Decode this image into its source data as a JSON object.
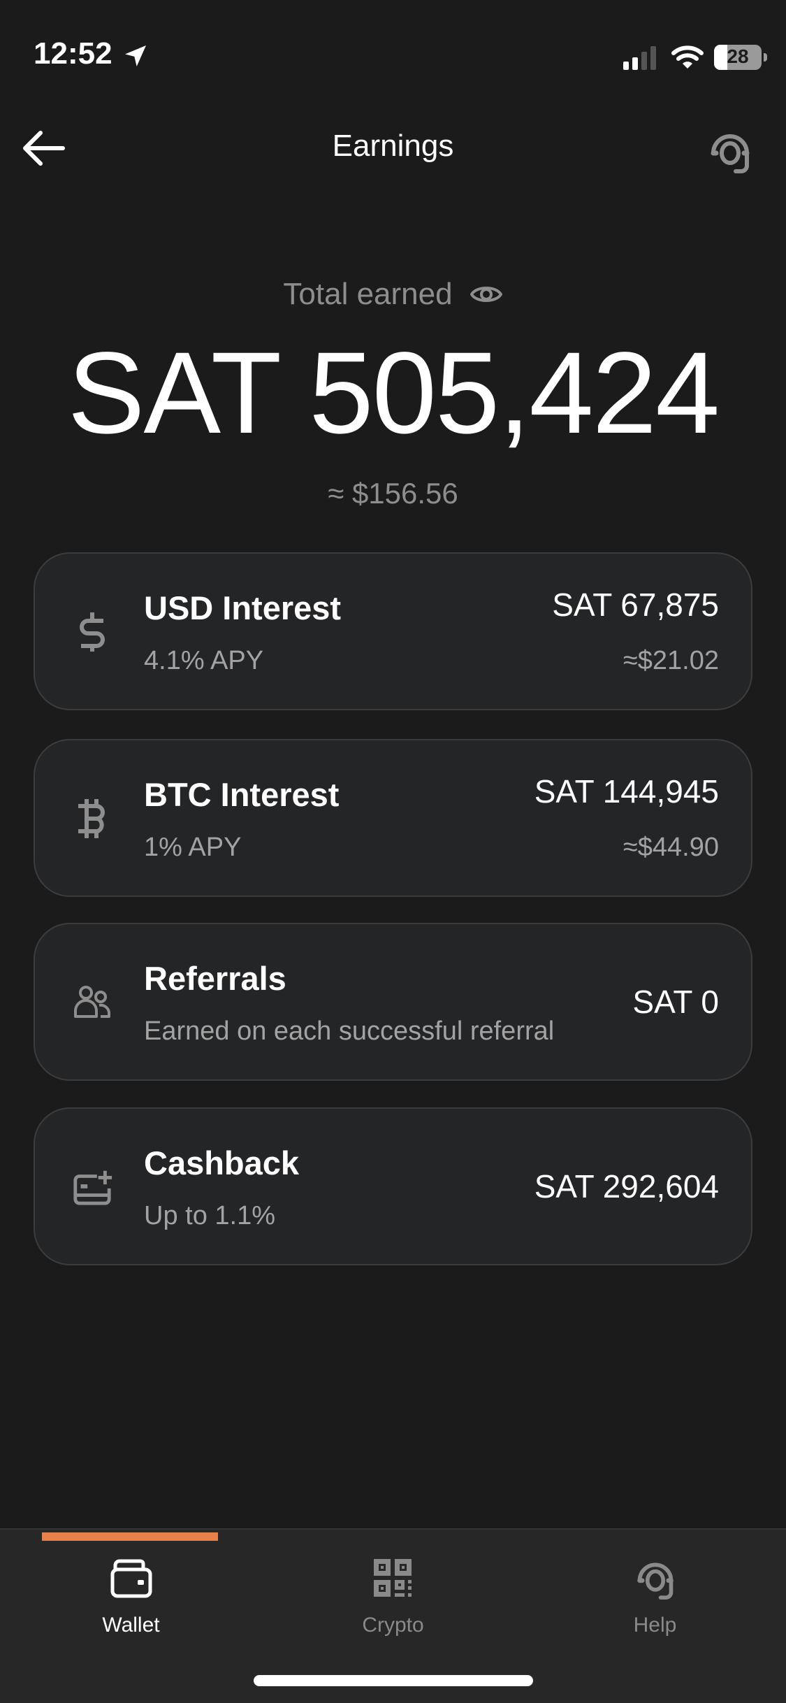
{
  "status_bar": {
    "time": "12:52",
    "location_icon": "location-arrow-icon",
    "signal_icon": "cellular-signal-icon",
    "wifi_icon": "wifi-icon",
    "battery_percent": "28",
    "battery_level": 0.28
  },
  "header": {
    "title": "Earnings",
    "back_icon": "arrow-left-icon",
    "support_icon": "headset-icon"
  },
  "summary": {
    "label": "Total earned",
    "visibility_icon": "eye-icon",
    "amount": "SAT 505,424",
    "usd_equivalent": "≈ $156.56"
  },
  "earnings": [
    {
      "id": "usd-interest",
      "icon": "dollar-icon",
      "title": "USD Interest",
      "subtitle": "4.1% APY",
      "amount": "SAT 67,875",
      "usd": "≈$21.02"
    },
    {
      "id": "btc-interest",
      "icon": "bitcoin-icon",
      "title": "BTC Interest",
      "subtitle": "1% APY",
      "amount": "SAT 144,945",
      "usd": "≈$44.90"
    },
    {
      "id": "referrals",
      "icon": "users-icon",
      "title": "Referrals",
      "subtitle": "Earned on each successful referral",
      "amount": "SAT 0"
    },
    {
      "id": "cashback",
      "icon": "card-plus-icon",
      "title": "Cashback",
      "subtitle": "Up to 1.1%",
      "amount": "SAT 292,604"
    }
  ],
  "tab_bar": {
    "tabs": [
      {
        "label": "Wallet",
        "icon": "wallet-icon",
        "active": true
      },
      {
        "label": "Crypto",
        "icon": "qr-code-icon",
        "active": false
      },
      {
        "label": "Help",
        "icon": "headset-icon",
        "active": false
      }
    ]
  },
  "colors": {
    "background": "#1b1b1c",
    "card": "#242527",
    "card_border": "#3b3c3e",
    "accent": "#e8804a",
    "muted_text": "#8e8e8e"
  }
}
